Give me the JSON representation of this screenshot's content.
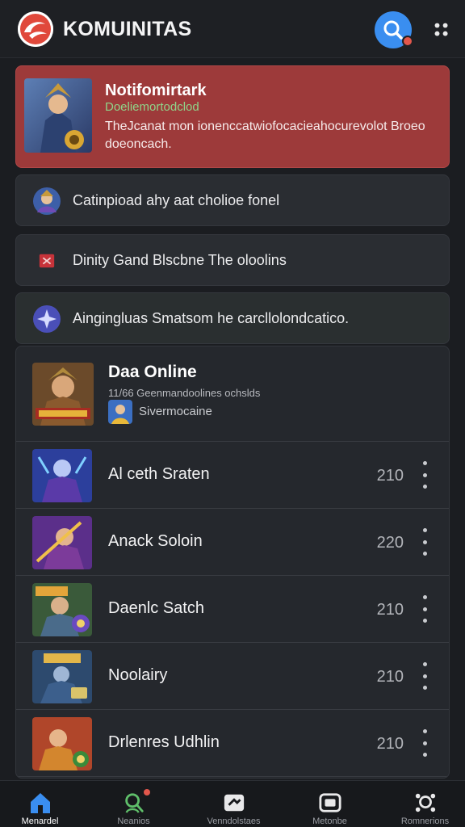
{
  "header": {
    "title": "KOMUINITAS",
    "logo_icon": "swirl-logo-icon",
    "search_icon": "search-icon",
    "menu_icon": "grid-menu-icon",
    "accent": "#3a8ef0"
  },
  "notification": {
    "title": "Notifomirtark",
    "subtitle": "Doeliemortodclod",
    "body": "TheJcanat mon ionenccatwiofocacieahocurevolot Broeo doeoncach.",
    "bg_color": "#9d3a3a"
  },
  "rows": [
    {
      "icon": "avatar-icon",
      "text": "Catinpioad ahy aat cholioe fonel"
    },
    {
      "icon": "flag-icon",
      "text": "Dinity Gand Blscbne The oloolins"
    },
    {
      "icon": "spark-icon",
      "text": "Aingingluas Smatsom he carcllolondcatico."
    }
  ],
  "featured": {
    "title": "Daa Online",
    "meta": "11/66 Geenmandoolines ochslds",
    "mini_label": "Sivermocaine"
  },
  "games": [
    {
      "name": "Al ceth Sraten",
      "count": "210"
    },
    {
      "name": "Anack Soloin",
      "count": "220"
    },
    {
      "name": "Daenlc Satch",
      "count": "210"
    },
    {
      "name": "Noolairy",
      "count": "210"
    },
    {
      "name": "Drlenres Udhlin",
      "count": "210"
    }
  ],
  "nav": [
    {
      "label": "Menardel",
      "icon": "home-icon"
    },
    {
      "label": "Neanios",
      "icon": "search-people-icon"
    },
    {
      "label": "Venndolstaes",
      "icon": "ticket-icon"
    },
    {
      "label": "Metonbe",
      "icon": "camera-icon"
    },
    {
      "label": "Romnerions",
      "icon": "gear-people-icon"
    }
  ]
}
